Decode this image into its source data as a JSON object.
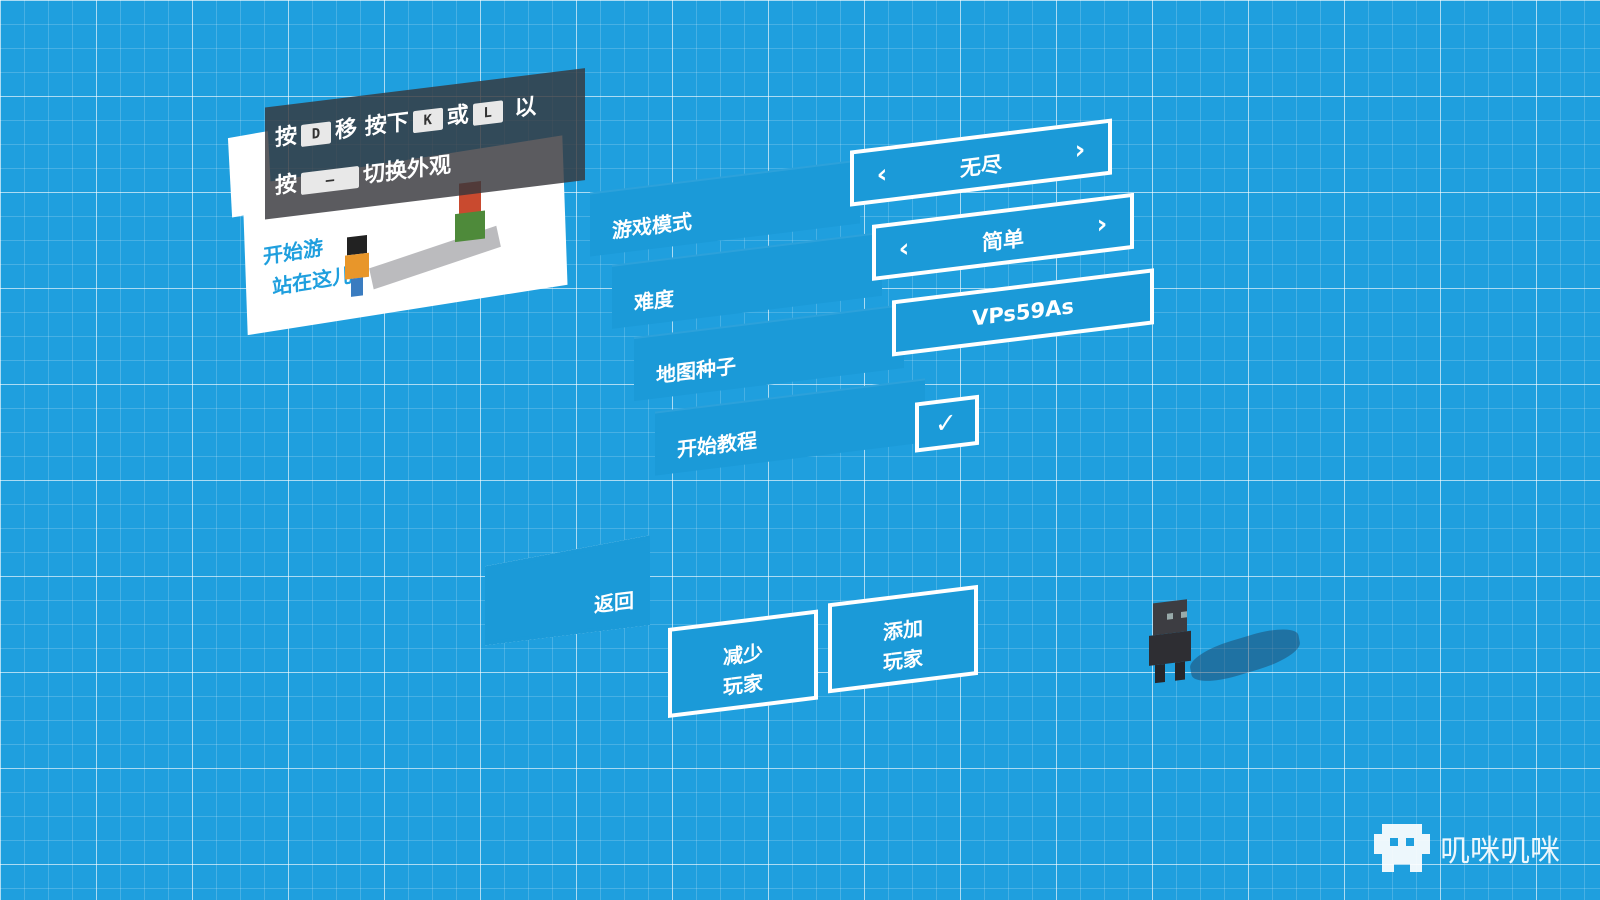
{
  "hint": {
    "line1_a": "按",
    "key_d": "D",
    "line1_b": "移",
    "line1_c": "按下",
    "key_k": "K",
    "line1_d": "或",
    "key_l": "L",
    "line1_e": "以",
    "line2_a": "按",
    "key_dash": "—",
    "line2_b": "切换外观"
  },
  "card": {
    "line1": "开始游",
    "line2": "站在这儿"
  },
  "settings": {
    "mode_label": "游戏模式",
    "mode_value": "无尽",
    "difficulty_label": "难度",
    "difficulty_value": "简单",
    "seed_label": "地图种子",
    "seed_value": "VPs59As",
    "tutorial_label": "开始教程",
    "tutorial_checked": true,
    "arrow_left": "‹",
    "arrow_right": "›",
    "check_glyph": "✓"
  },
  "buttons": {
    "back": "返回",
    "remove_player_l1": "减少",
    "remove_player_l2": "玩家",
    "add_player_l1": "添加",
    "add_player_l2": "玩家"
  },
  "watermark": {
    "text": "叽咪叽咪"
  },
  "colors": {
    "background": "#1f9fde",
    "panel": "#1b9ad8",
    "border": "#ffffff",
    "hint_bg": "#37373c"
  }
}
